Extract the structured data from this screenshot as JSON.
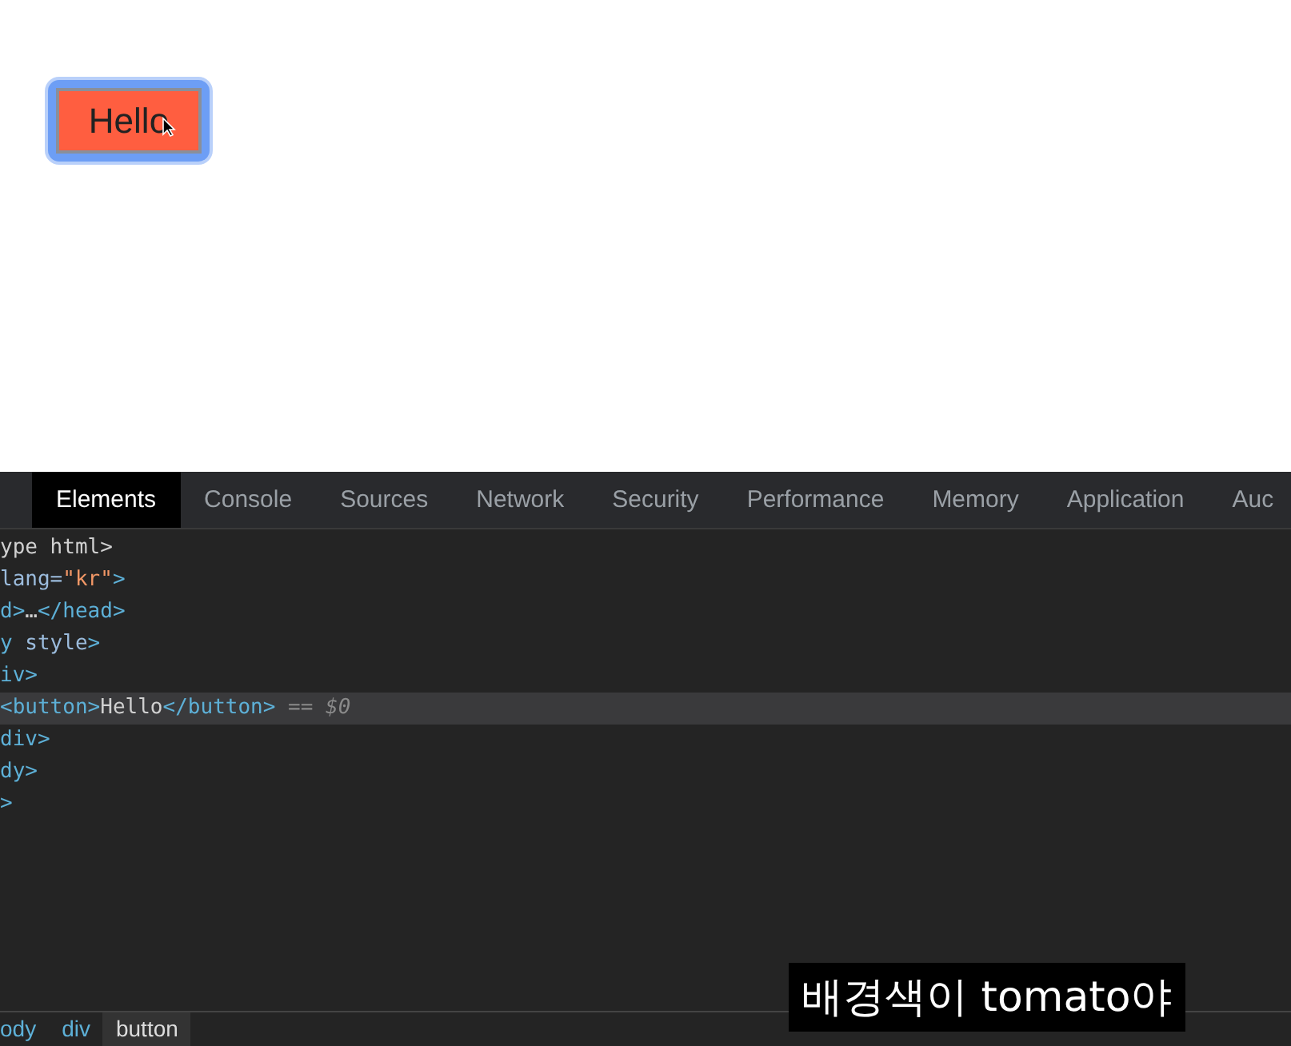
{
  "page": {
    "button": {
      "label": "Hello",
      "focused": true
    }
  },
  "devtools": {
    "tabs": [
      {
        "label": "Elements",
        "selected": true
      },
      {
        "label": "Console",
        "selected": false
      },
      {
        "label": "Sources",
        "selected": false
      },
      {
        "label": "Network",
        "selected": false
      },
      {
        "label": "Security",
        "selected": false
      },
      {
        "label": "Performance",
        "selected": false
      },
      {
        "label": "Memory",
        "selected": false
      },
      {
        "label": "Application",
        "selected": false
      },
      {
        "label": "Auc",
        "selected": false
      }
    ],
    "lines": [
      {
        "selected": false,
        "segments": [
          {
            "kind": "text",
            "text": "ype html>"
          }
        ]
      },
      {
        "selected": false,
        "segments": [
          {
            "kind": "attr",
            "text": "lang="
          },
          {
            "kind": "value",
            "text": "\"kr\""
          },
          {
            "kind": "tag",
            "text": ">"
          }
        ]
      },
      {
        "selected": false,
        "segments": [
          {
            "kind": "tag",
            "text": "d>"
          },
          {
            "kind": "text",
            "text": "…"
          },
          {
            "kind": "tag",
            "text": "</head>"
          }
        ]
      },
      {
        "selected": false,
        "segments": [
          {
            "kind": "tag",
            "text": "y"
          },
          {
            "kind": "attr",
            "text": " style"
          },
          {
            "kind": "tag",
            "text": ">"
          }
        ]
      },
      {
        "selected": false,
        "segments": [
          {
            "kind": "tag",
            "text": "iv>"
          }
        ]
      },
      {
        "selected": true,
        "segments": [
          {
            "kind": "tag",
            "text": "<button>"
          },
          {
            "kind": "text",
            "text": "Hello"
          },
          {
            "kind": "tag",
            "text": "</button>"
          },
          {
            "kind": "note",
            "text": " == $0"
          }
        ]
      },
      {
        "selected": false,
        "segments": [
          {
            "kind": "tag",
            "text": "div>"
          }
        ]
      },
      {
        "selected": false,
        "segments": [
          {
            "kind": "tag",
            "text": "dy>"
          }
        ]
      },
      {
        "selected": false,
        "segments": [
          {
            "kind": "tag",
            "text": ">"
          }
        ]
      }
    ],
    "breadcrumbs": [
      {
        "label": "ody",
        "selected": false
      },
      {
        "label": "div",
        "selected": false
      },
      {
        "label": "button",
        "selected": true
      }
    ]
  },
  "caption": "배경색이 tomato야"
}
